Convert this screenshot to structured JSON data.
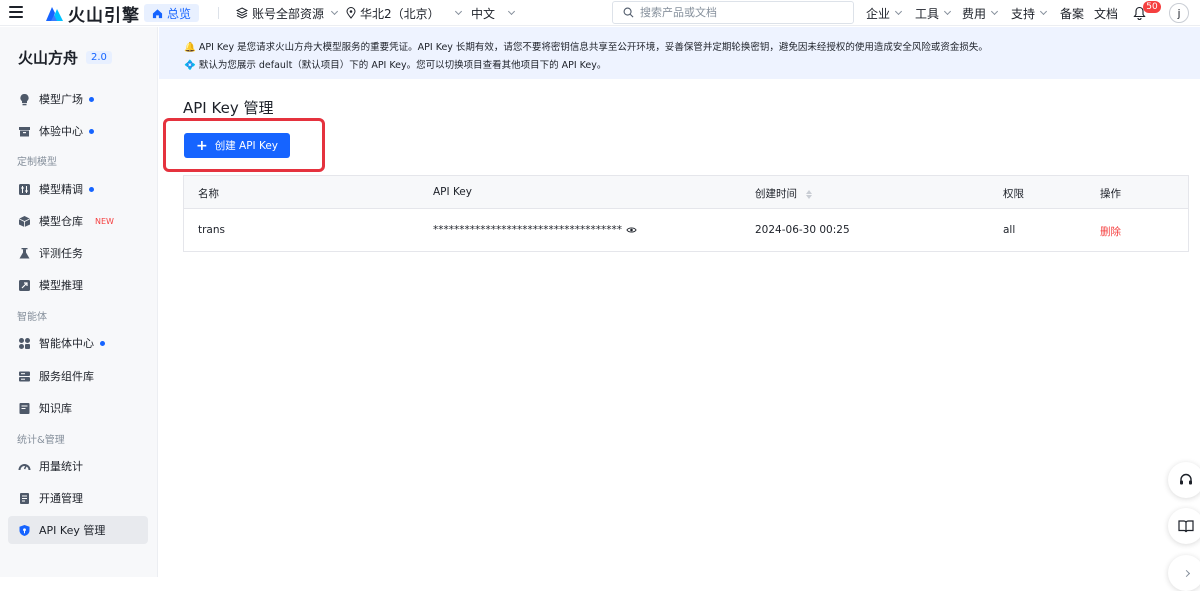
{
  "topbar": {
    "logo_text": "火山引擎",
    "home_label": "总览",
    "account_label": "账号全部资源",
    "region_label": "华北2（北京）",
    "lang_label": "中文",
    "search_placeholder": "搜索产品或文档",
    "menu": [
      "企业",
      "工具",
      "费用",
      "支持",
      "备案",
      "文档"
    ],
    "notification_count": "50",
    "avatar_letter": "j"
  },
  "sidebar": {
    "brand": "火山方舟",
    "version": "2.0",
    "items": [
      {
        "label": "模型广场",
        "icon": "bulb-icon",
        "dot": true
      },
      {
        "label": "体验中心",
        "icon": "box-icon",
        "dot": true
      },
      {
        "label": "模型精调",
        "icon": "tune-icon",
        "dot": true
      },
      {
        "label": "模型仓库",
        "icon": "cube-icon",
        "tag": "NEW"
      },
      {
        "label": "评测任务",
        "icon": "flask-icon"
      },
      {
        "label": "模型推理",
        "icon": "inference-icon"
      },
      {
        "label": "智能体中心",
        "icon": "agent-grid-icon",
        "dot": true
      },
      {
        "label": "服务组件库",
        "icon": "server-icon"
      },
      {
        "label": "知识库",
        "icon": "book-icon"
      },
      {
        "label": "用量统计",
        "icon": "gauge-icon"
      },
      {
        "label": "开通管理",
        "icon": "doc-icon"
      },
      {
        "label": "API Key 管理",
        "icon": "shield-key-icon",
        "active": true
      }
    ],
    "sections": [
      "定制模型",
      "智能体",
      "统计&管理"
    ]
  },
  "notice": {
    "line1": "🔔 API Key 是您请求火山方舟大模型服务的重要凭证。API Key 长期有效，请您不要将密钥信息共享至公开环境，妥善保管并定期轮换密钥，避免因未经授权的使用造成安全风险或资金损失。",
    "line2": "💠 默认为您展示 default（默认项目）下的 API Key。您可以切换项目查看其他项目下的 API Key。"
  },
  "main": {
    "title": "API Key 管理",
    "create_button": "创建 API Key",
    "table": {
      "columns": [
        "名称",
        "API Key",
        "创建时间",
        "权限",
        "操作"
      ],
      "rows": [
        {
          "name": "trans",
          "api_key": "************************************",
          "created": "2024-06-30 00:25",
          "permission": "all",
          "action": "删除"
        }
      ]
    }
  },
  "colors": {
    "accent": "#1664ff",
    "danger": "#f53f3f",
    "highlight_box": "#e5323e"
  }
}
